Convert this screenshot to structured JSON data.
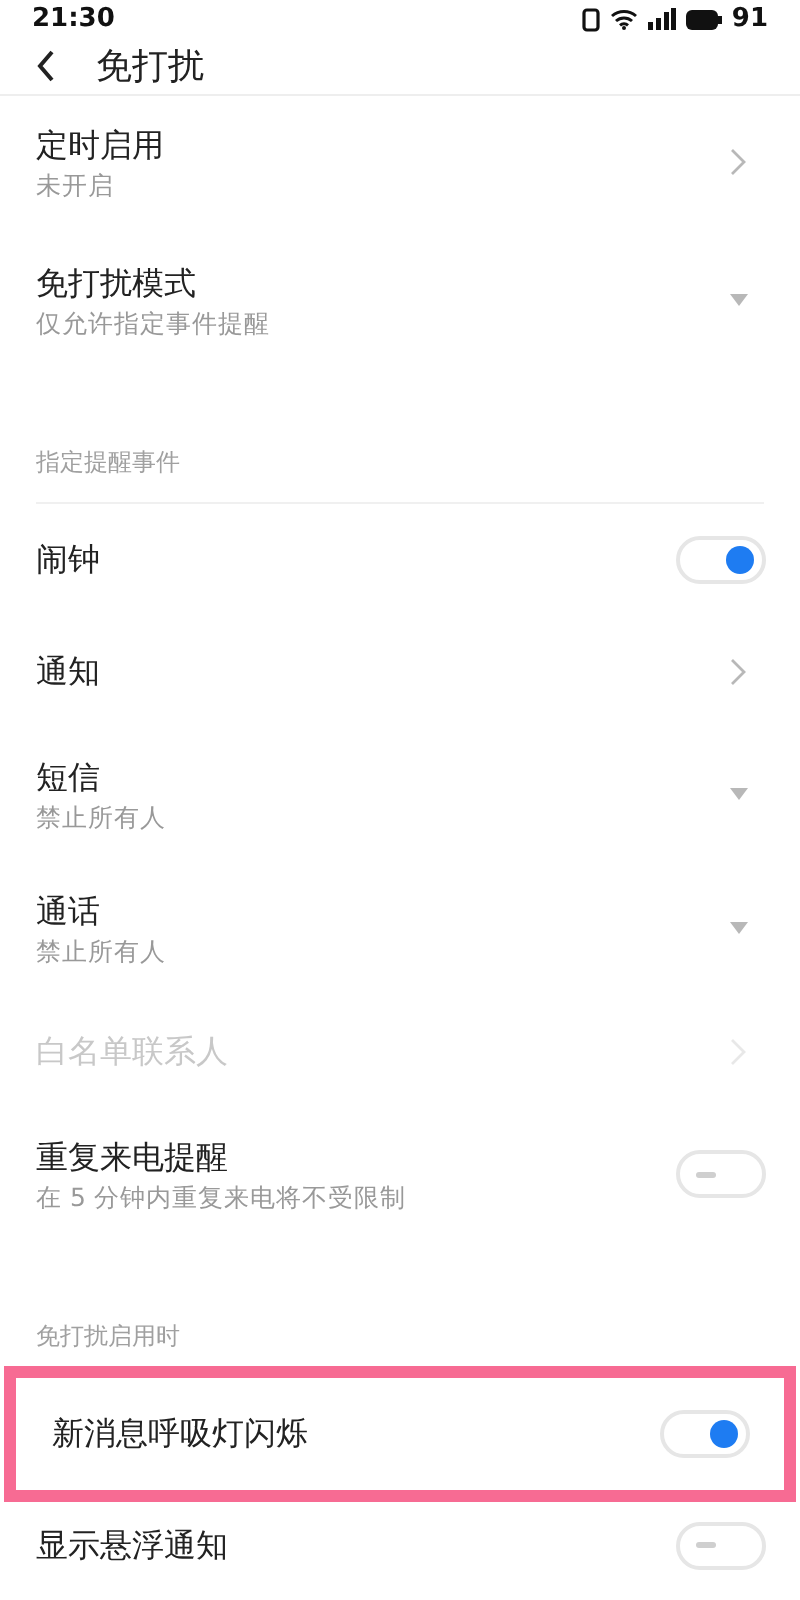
{
  "status_bar": {
    "time": "21:30",
    "battery": "91"
  },
  "header": {
    "title": "免打扰"
  },
  "sections": [
    {
      "items": [
        {
          "kind": "chevron",
          "title": "定时启用",
          "subtitle": "未开启",
          "disabled": false,
          "highlighted": false
        },
        {
          "kind": "dropdown",
          "title": "免打扰模式",
          "subtitle": "仅允许指定事件提醒",
          "disabled": false,
          "highlighted": false
        }
      ]
    },
    {
      "heading": "指定提醒事件",
      "items": [
        {
          "kind": "toggle",
          "title": "闹钟",
          "on": true,
          "disabled": false,
          "highlighted": false
        },
        {
          "kind": "chevron",
          "title": "通知",
          "disabled": false,
          "highlighted": false
        },
        {
          "kind": "dropdown",
          "title": "短信",
          "subtitle": "禁止所有人",
          "disabled": false,
          "highlighted": false
        },
        {
          "kind": "dropdown",
          "title": "通话",
          "subtitle": "禁止所有人",
          "disabled": false,
          "highlighted": false
        },
        {
          "kind": "chevron",
          "title": "白名单联系人",
          "disabled": true,
          "highlighted": false
        },
        {
          "kind": "toggle",
          "title": "重复来电提醒",
          "subtitle": "在 5 分钟内重复来电将不受限制",
          "on": false,
          "disabled": false,
          "highlighted": false
        }
      ]
    },
    {
      "heading": "免打扰启用时",
      "items": [
        {
          "kind": "toggle",
          "title": "新消息呼吸灯闪烁",
          "on": true,
          "disabled": false,
          "highlighted": true
        },
        {
          "kind": "toggle",
          "title": "显示悬浮通知",
          "on": false,
          "disabled": false,
          "highlighted": false
        }
      ]
    }
  ]
}
